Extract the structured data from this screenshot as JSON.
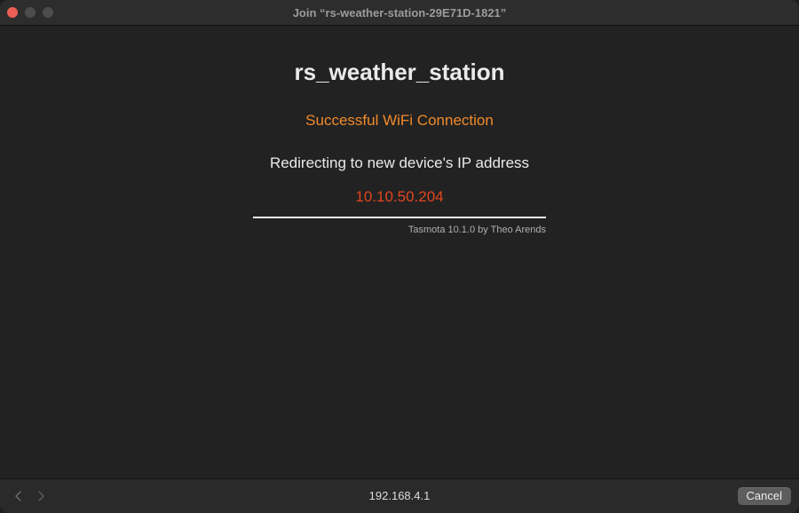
{
  "window": {
    "title": "Join “rs-weather-station-29E71D-1821”"
  },
  "page": {
    "device_name": "rs_weather_station",
    "status": "Successful WiFi Connection",
    "redirect_text": "Redirecting to new device's IP address",
    "ip_address": "10.10.50.204",
    "credit": "Tasmota 10.1.0 by Theo Arends"
  },
  "bottom_bar": {
    "url": "192.168.4.1",
    "cancel_label": "Cancel",
    "back_icon": "chevron-left-icon",
    "forward_icon": "chevron-right-icon"
  },
  "colors": {
    "status": "#f08a2b",
    "ip": "#e2451f",
    "close_button": "#ed5f56"
  }
}
